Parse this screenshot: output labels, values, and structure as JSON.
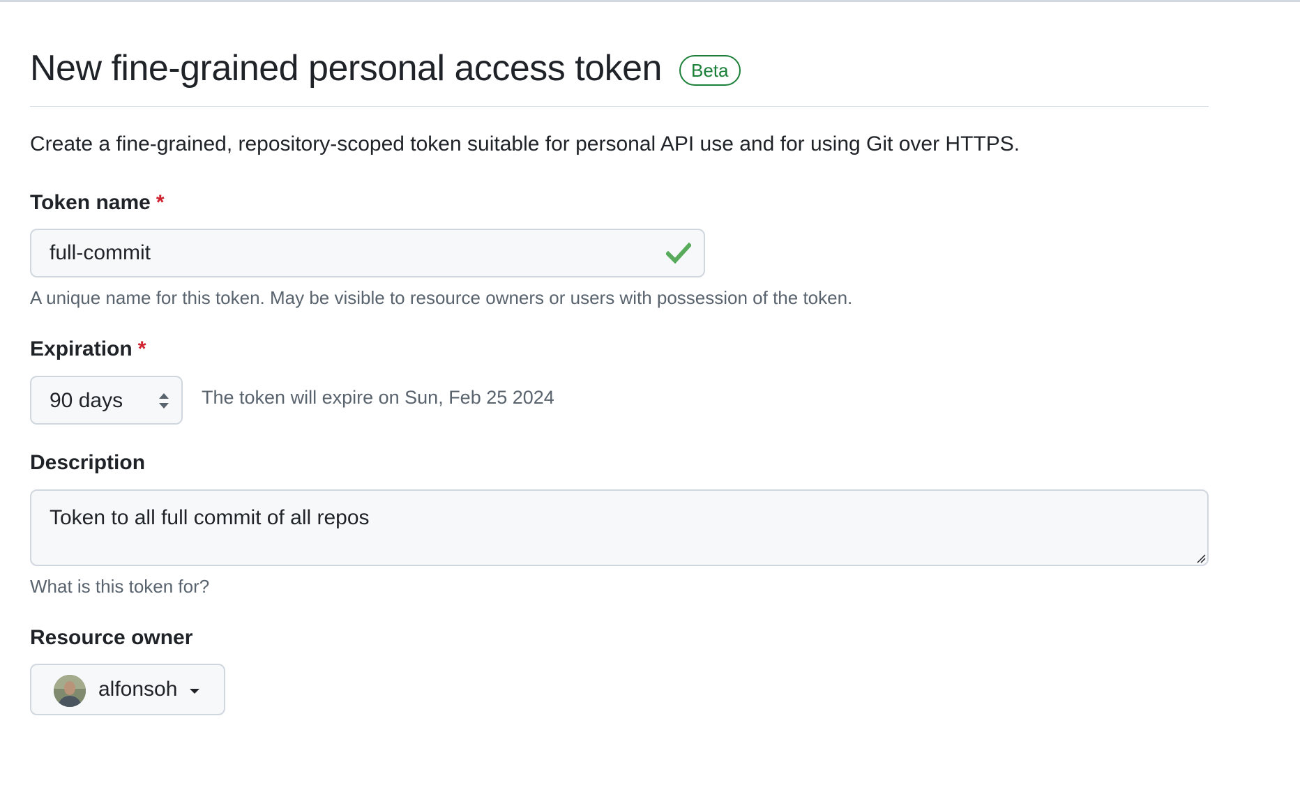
{
  "header": {
    "title": "New fine-grained personal access token",
    "badge": "Beta"
  },
  "intro": "Create a fine-grained, repository-scoped token suitable for personal API use and for using Git over HTTPS.",
  "token_name": {
    "label": "Token name",
    "required_mark": "*",
    "value": "full-commit",
    "valid_icon": "check-icon",
    "hint": "A unique name for this token. May be visible to resource owners or users with possession of the token."
  },
  "expiration": {
    "label": "Expiration",
    "required_mark": "*",
    "selected": "90 days",
    "note": "The token will expire on Sun, Feb 25 2024"
  },
  "description": {
    "label": "Description",
    "value": "Token to all full commit of all repos",
    "hint": "What is this token for?"
  },
  "resource_owner": {
    "label": "Resource owner",
    "selected": "alfonsoh"
  },
  "colors": {
    "accent_green": "#1a7f37",
    "check_green": "#57ab5a",
    "required_red": "#cf222e",
    "muted_text": "#59636e",
    "border": "#d0d7de",
    "input_bg": "#f6f8fa"
  }
}
